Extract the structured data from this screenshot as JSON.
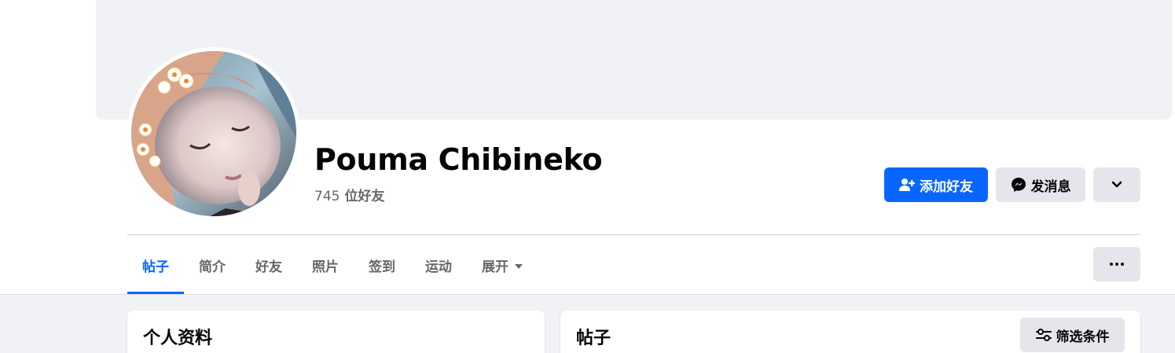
{
  "profile": {
    "name": "Pouma Chibineko",
    "friends_count": "745",
    "friends_label": "位好友"
  },
  "actions": {
    "add_friend": "添加好友",
    "message": "发消息",
    "more_icon": "chevron-down-icon",
    "dots_icon": "more-dots-icon"
  },
  "tabs": [
    {
      "label": "帖子",
      "active": true
    },
    {
      "label": "简介"
    },
    {
      "label": "好友"
    },
    {
      "label": "照片"
    },
    {
      "label": "签到"
    },
    {
      "label": "运动"
    },
    {
      "label": "展开"
    }
  ],
  "sections": {
    "about_title": "个人资料",
    "posts_title": "帖子",
    "filter_label": "筛选条件"
  },
  "colors": {
    "accent": "#0866ff",
    "secondary_button": "#e4e6eb",
    "page_bg": "#f0f2f5",
    "muted_text": "#65676b"
  }
}
